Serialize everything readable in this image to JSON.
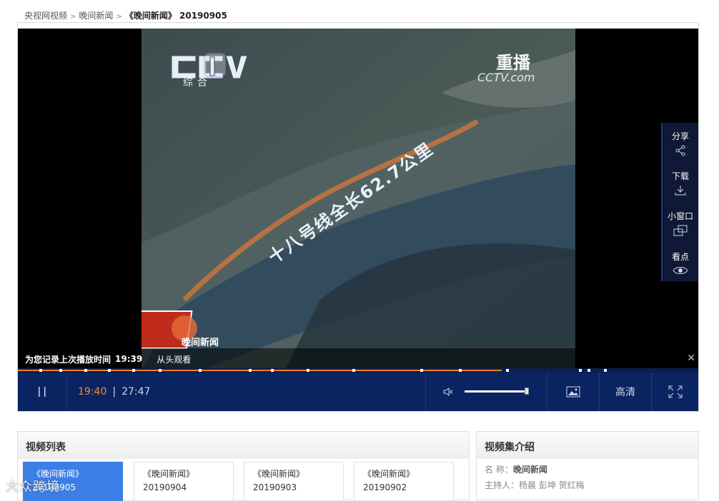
{
  "breadcrumb": {
    "items": [
      "央视网视频",
      "晚间新闻"
    ],
    "separator": ">",
    "current": "《晚间新闻》 20190905"
  },
  "video": {
    "channel_logo": "CCTV 1",
    "channel_sub": "综合",
    "replay_label": "重播",
    "site_logo": "CCTV.com",
    "map_caption": "十八号线全长62.7公里",
    "program_logo": "晚间新闻"
  },
  "side_panel": {
    "items": [
      {
        "label": "分享",
        "icon": "share-icon"
      },
      {
        "label": "下载",
        "icon": "download-icon"
      },
      {
        "label": "小窗口",
        "icon": "mini-window-icon"
      },
      {
        "label": "看点",
        "icon": "eye-icon"
      }
    ]
  },
  "resume_bar": {
    "message": "为您记录上次播放时间",
    "time": "19:39",
    "restart_label": "从头观看",
    "close_icon": "close-icon"
  },
  "player": {
    "current_time": "19:40",
    "separator": "|",
    "duration": "27:47",
    "progress_fraction": 0.711,
    "volume_fraction": 1.0,
    "quality_label": "高清",
    "icons": {
      "play_pause": "pause-icon",
      "volume": "volume-icon",
      "screenshot": "screenshot-icon",
      "fullscreen": "fullscreen-icon"
    },
    "accent_color": "#ff7f1a",
    "bar_color": "#0a2461"
  },
  "video_list": {
    "title": "视频列表",
    "episodes": [
      {
        "name": "《晚间新闻》",
        "date": "20190905",
        "active": true
      },
      {
        "name": "《晚间新闻》",
        "date": "20190904",
        "active": false
      },
      {
        "name": "《晚间新闻》",
        "date": "20190903",
        "active": false
      },
      {
        "name": "《晚间新闻》",
        "date": "20190902",
        "active": false
      }
    ]
  },
  "intro": {
    "title": "视频集介绍",
    "name_label": "名  称：",
    "name_value": "晚间新闻",
    "host_label": "主持人：",
    "host_value": "杨晨 彭坤 贺红梅"
  },
  "watermark": "大众跨境"
}
